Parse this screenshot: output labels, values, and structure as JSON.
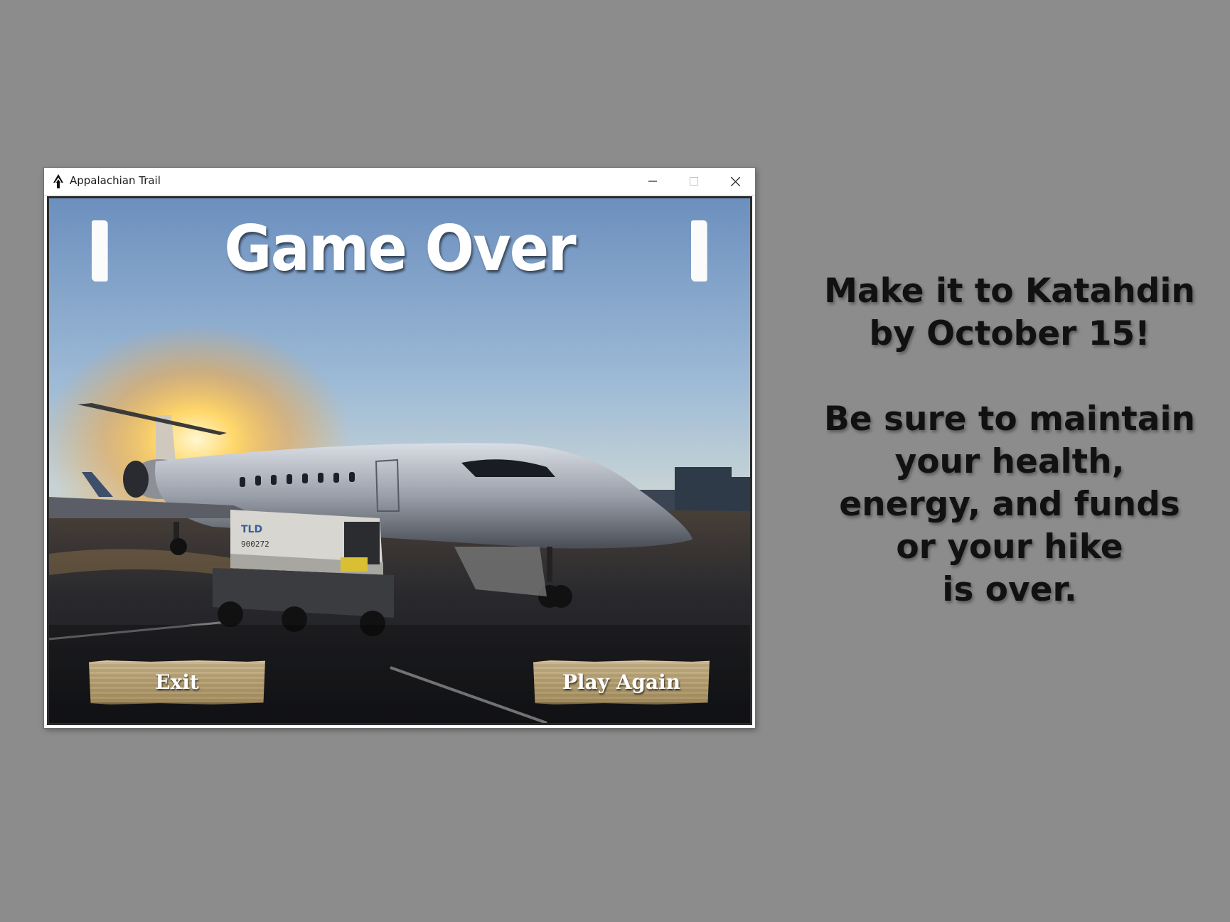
{
  "window": {
    "title": "Appalachian Trail",
    "app_icon": "trail-marker-icon",
    "controls": [
      "minimize-icon",
      "maximize-icon",
      "close-icon"
    ]
  },
  "game": {
    "headline": "Game Over",
    "background_scene": "regional jet on airport tarmac at sunset",
    "buttons": {
      "exit_label": "Exit",
      "play_again_label": "Play Again"
    }
  },
  "instructions": {
    "goal_line_1": "Make it to Katahdin",
    "goal_line_2": "by October 15!",
    "warn_line_1": "Be sure to maintain",
    "warn_line_2": "your health,",
    "warn_line_3": "energy, and funds",
    "warn_line_4": "or your hike",
    "warn_line_5": "is over."
  },
  "colors": {
    "desktop_bg": "#8c8c8c",
    "button_wood": "#b6a072",
    "headline": "#ffffff",
    "instruction_text": "#111111"
  }
}
